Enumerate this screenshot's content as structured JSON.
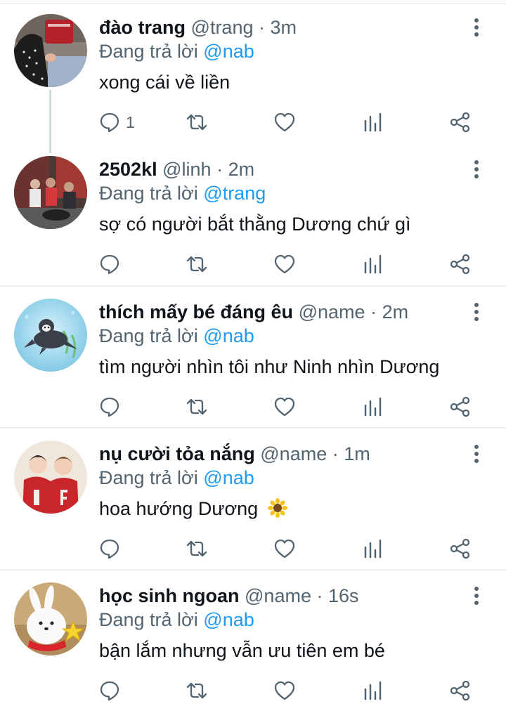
{
  "tweets": [
    {
      "display_name": "đào trang",
      "handle": "@trang",
      "time": "3m",
      "reply_prefix": "Đang trả lời",
      "reply_to": "@nab",
      "text": "xong cái về liền",
      "reply_count": "1"
    },
    {
      "display_name": "2502kl",
      "handle": "@linh",
      "time": "2m",
      "reply_prefix": "Đang trả lời",
      "reply_to": "@trang",
      "text": "sợ có người bắt thằng Dương chứ gì",
      "reply_count": ""
    },
    {
      "display_name": "thích mấy bé đáng êu",
      "handle": "@name",
      "time": "2m",
      "reply_prefix": "Đang trả lời",
      "reply_to": "@nab",
      "text": "tìm người nhìn tôi như Ninh nhìn Dương",
      "reply_count": ""
    },
    {
      "display_name": "nụ cười tỏa nắng",
      "handle": "@name",
      "time": "1m",
      "reply_prefix": "Đang trả lời",
      "reply_to": "@nab",
      "text": "hoa hướng Dương",
      "reply_count": ""
    },
    {
      "display_name": "học sinh ngoan",
      "handle": "@name",
      "time": "16s",
      "reply_prefix": "Đang trả lời",
      "reply_to": "@nab",
      "text": "bận lắm nhưng vẫn ưu tiên em bé",
      "reply_count": ""
    }
  ],
  "separator": "·",
  "icons": {
    "reply": "reply-bubble-icon",
    "retweet": "retweet-icon",
    "like": "heart-icon",
    "views": "views-bar-chart-icon",
    "share": "share-icon",
    "more": "more-vertical-icon",
    "emoji": "sunflower-emoji-icon"
  },
  "colors": {
    "text": "#0f1419",
    "secondary": "#536471",
    "mention": "#1d9bf0",
    "divider": "#eff1f3",
    "thread": "#cfd9de"
  }
}
